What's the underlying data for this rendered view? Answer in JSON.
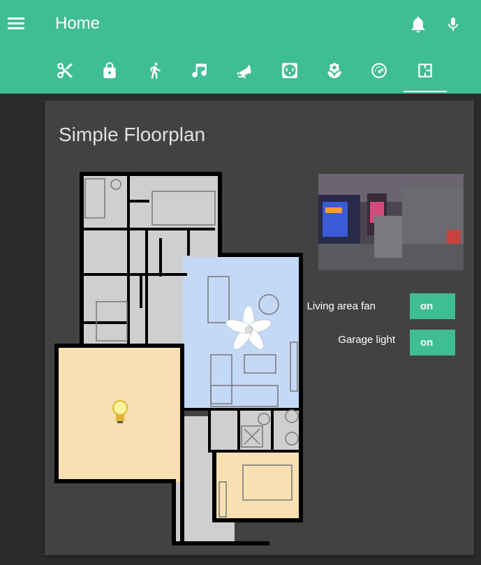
{
  "header": {
    "title": "Home",
    "menu_icon": "menu-icon",
    "bell_icon": "bell-icon",
    "mic_icon": "microphone-icon",
    "tabs": [
      {
        "icon": "scissors-icon"
      },
      {
        "icon": "lock-icon"
      },
      {
        "icon": "walking-person-icon"
      },
      {
        "icon": "music-note-icon"
      },
      {
        "icon": "cctv-camera-icon"
      },
      {
        "icon": "power-outlet-icon"
      },
      {
        "icon": "flower-icon"
      },
      {
        "icon": "gauge-icon"
      },
      {
        "icon": "floorplan-icon",
        "active": true
      }
    ]
  },
  "card": {
    "title": "Simple Floorplan",
    "controls": [
      {
        "label": "Living area fan",
        "state": "on"
      },
      {
        "label": "Garage light",
        "state": "on"
      }
    ]
  },
  "colors": {
    "accent": "#3fbe91",
    "card_bg": "#424242",
    "page_bg": "#2b2b2b",
    "living_area_highlight": "#c4d9f7",
    "light_on_highlight": "#f8e0b2"
  }
}
